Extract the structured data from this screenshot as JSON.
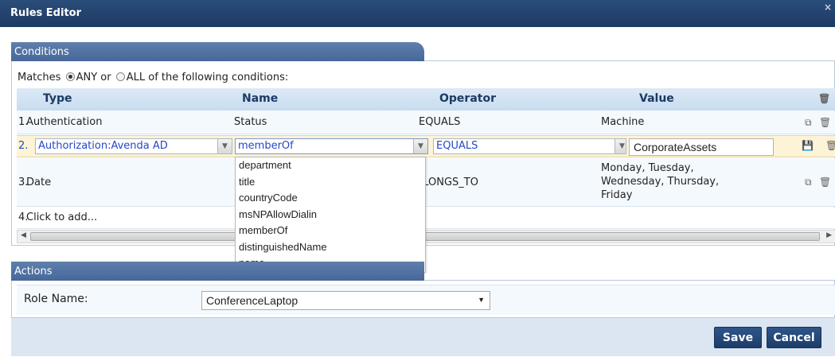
{
  "window": {
    "title": "Rules Editor",
    "close_glyph": "×"
  },
  "conditions": {
    "section_title": "Conditions",
    "matches_prefix": "Matches",
    "option_any": "ANY",
    "or_text": "or",
    "option_all": "ALL",
    "matches_suffix": "of the following conditions:",
    "selected_option": "ANY",
    "columns": [
      "Type",
      "Name",
      "Operator",
      "Value"
    ],
    "rows": [
      {
        "num": "1.",
        "type": "Authentication",
        "name": "Status",
        "operator": "EQUALS",
        "value": "Machine"
      },
      {
        "num": "2.",
        "type": "Authorization:Avenda AD",
        "name": "memberOf",
        "operator": "EQUALS",
        "value": "CorporateAssets"
      },
      {
        "num": "3.",
        "type": "Date",
        "name": "",
        "operator": "BELONGS_TO",
        "value_lines": [
          "Monday, Tuesday,",
          "Wednesday, Thursday,",
          "Friday"
        ]
      },
      {
        "num": "4.",
        "type": "Click to add..."
      }
    ],
    "name_dropdown_options": [
      "department",
      "title",
      "countryCode",
      "msNPAllowDialin",
      "memberOf",
      "distinguishedName",
      "name"
    ],
    "visible_operator_row3": "ELONGS_TO"
  },
  "actions": {
    "section_title": "Actions",
    "role_label": "Role Name:",
    "role_value": "ConferenceLaptop"
  },
  "buttons": {
    "save": "Save",
    "cancel": "Cancel"
  },
  "icons": {
    "trash": "trash-icon",
    "copy": "copy-icon",
    "save_row": "save-row-icon",
    "dropdown": "chevron-down-icon"
  }
}
